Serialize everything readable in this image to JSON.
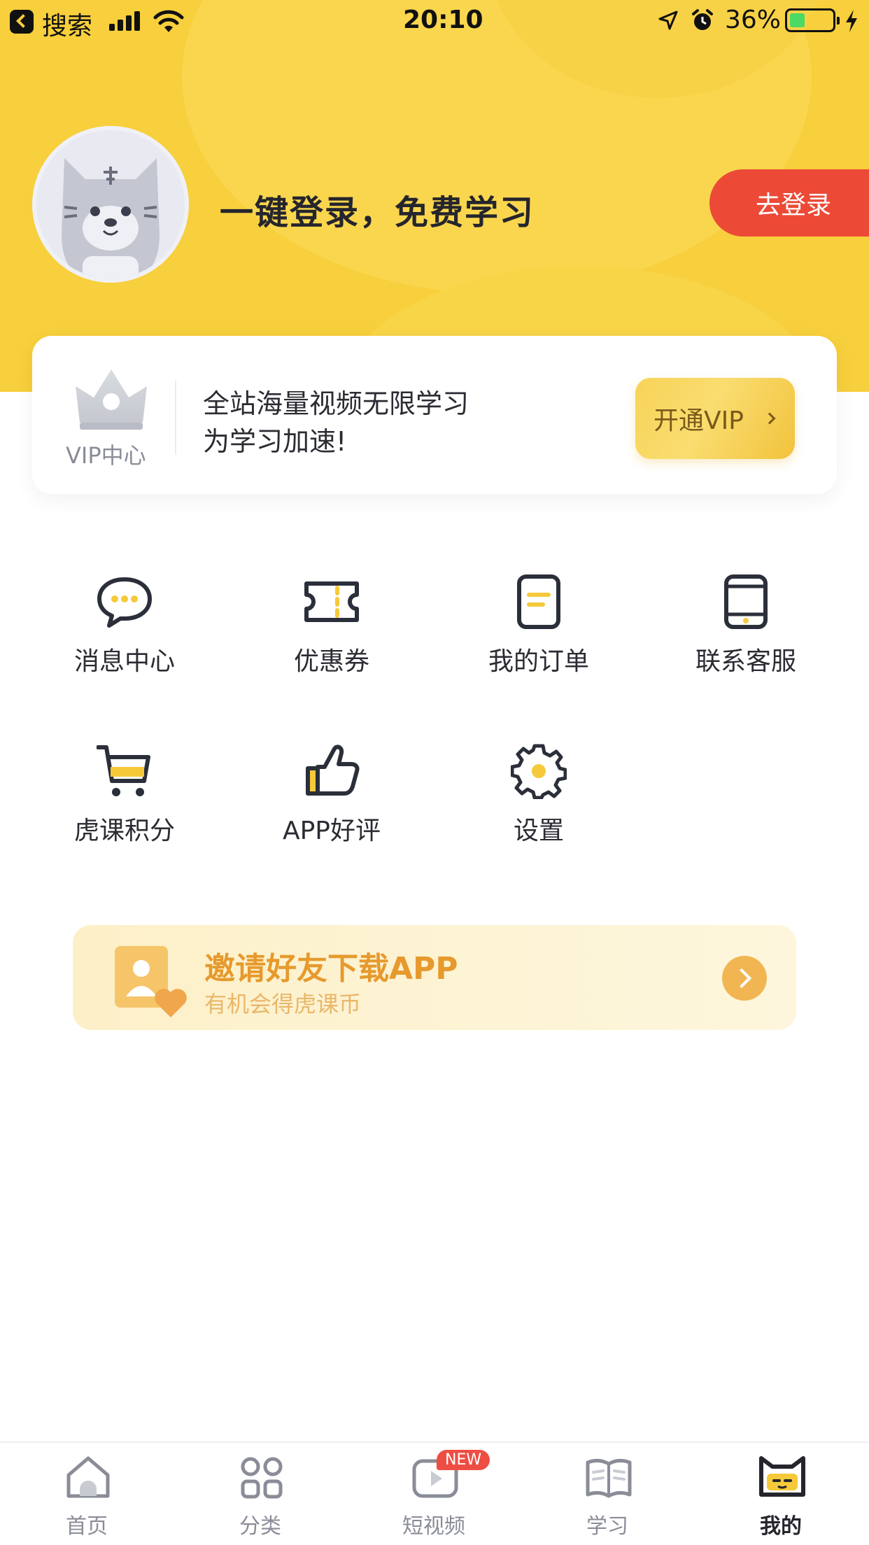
{
  "status_bar": {
    "back_label": "搜索",
    "time": "20:10",
    "battery_percent": "36%",
    "battery_level": 0.36
  },
  "profile": {
    "login_prompt": "一键登录，免费学习",
    "login_button": "去登录"
  },
  "vip_card": {
    "center_label": "VIP中心",
    "line1": "全站海量视频无限学习",
    "line2": "为学习加速!",
    "button_label": "开通VIP"
  },
  "menu": {
    "items": [
      {
        "label": "消息中心",
        "icon": "chat-bubble-icon"
      },
      {
        "label": "优惠券",
        "icon": "coupon-ticket-icon"
      },
      {
        "label": "我的订单",
        "icon": "order-document-icon"
      },
      {
        "label": "联系客服",
        "icon": "phone-icon"
      },
      {
        "label": "虎课积分",
        "icon": "cart-icon"
      },
      {
        "label": "APP好评",
        "icon": "thumbs-up-icon"
      },
      {
        "label": "设置",
        "icon": "gear-icon"
      }
    ]
  },
  "invite": {
    "title": "邀请好友下载APP",
    "subtitle": "有机会得虎课币"
  },
  "tabbar": {
    "tabs": [
      {
        "label": "首页",
        "icon": "home-icon"
      },
      {
        "label": "分类",
        "icon": "grid-icon"
      },
      {
        "label": "短视频",
        "icon": "video-icon",
        "badge": "NEW"
      },
      {
        "label": "学习",
        "icon": "book-icon"
      },
      {
        "label": "我的",
        "icon": "cat-face-icon",
        "active": true
      }
    ]
  },
  "colors": {
    "header_yellow": "#f8cf3c",
    "login_red": "#ec4a37",
    "accent_yellow": "#f5c93a",
    "icon_dark": "#2b2f3a",
    "invite_orange": "#e69a2e"
  }
}
